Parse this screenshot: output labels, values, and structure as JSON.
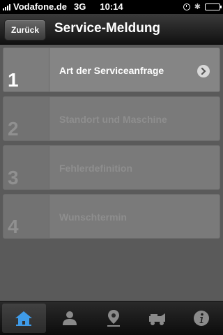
{
  "status_bar": {
    "carrier": "Vodafone.de",
    "network": "3G",
    "time": "10:14"
  },
  "nav": {
    "back_label": "Zurück",
    "title": "Service-Meldung"
  },
  "steps": [
    {
      "number": "1",
      "label": "Art der Serviceanfrage",
      "active": true
    },
    {
      "number": "2",
      "label": "Standort und Maschine",
      "active": false
    },
    {
      "number": "3",
      "label": "Fehlerdefinition",
      "active": false
    },
    {
      "number": "4",
      "label": "Wunschtermin",
      "active": false
    }
  ],
  "tabs": [
    {
      "icon": "home-icon",
      "active": true
    },
    {
      "icon": "person-icon",
      "active": false
    },
    {
      "icon": "location-pin-icon",
      "active": false
    },
    {
      "icon": "machine-icon",
      "active": false
    },
    {
      "icon": "info-icon",
      "active": false
    }
  ],
  "colors": {
    "accent_blue": "#3f9be8",
    "tab_icon_gray": "#8a8a8a"
  }
}
